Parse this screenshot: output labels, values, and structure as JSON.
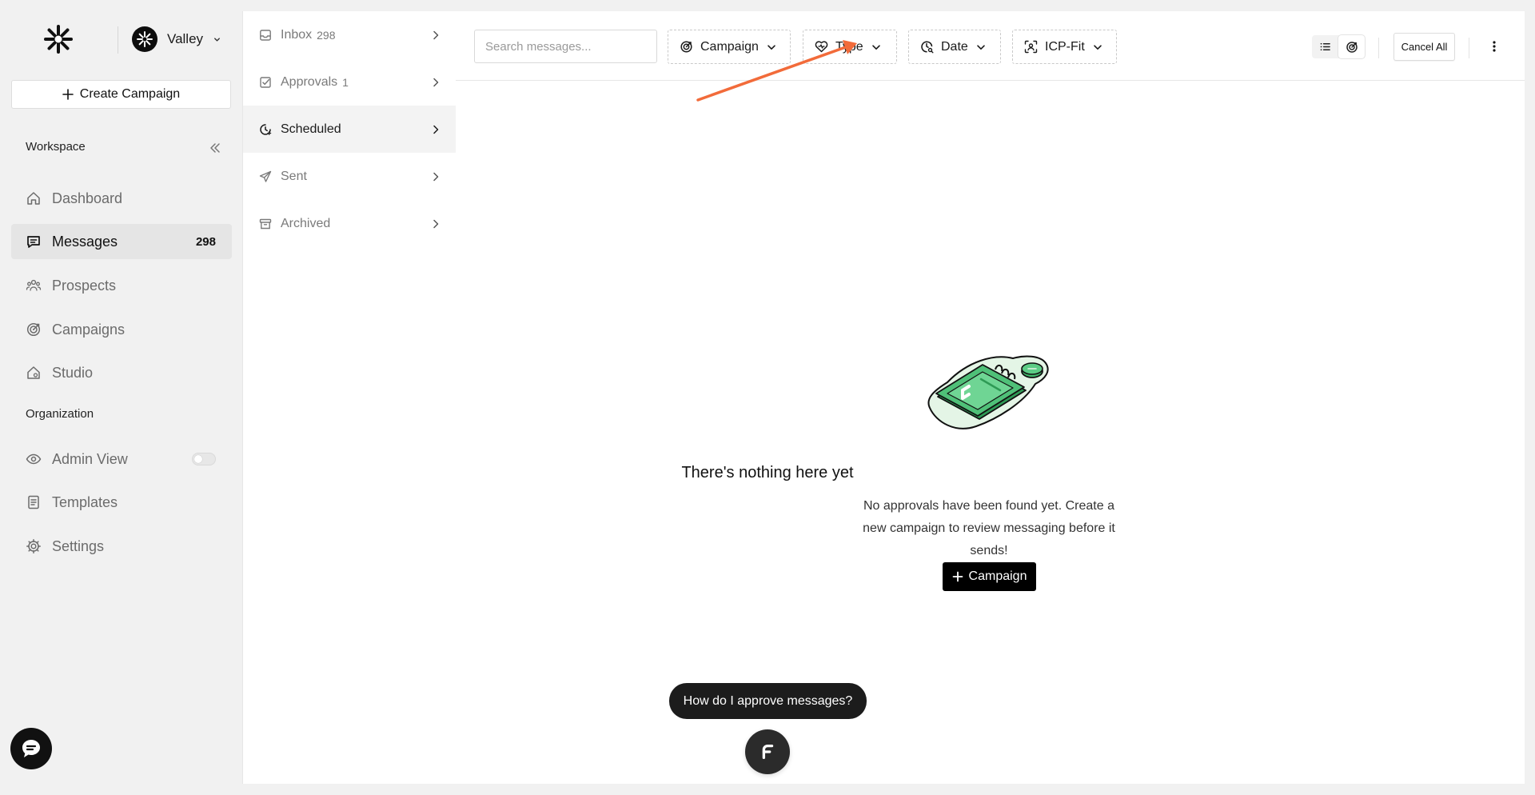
{
  "brand": {
    "logo_icon": "asterisk-logo-icon"
  },
  "org": {
    "name": "Valley"
  },
  "sidebar": {
    "create_label": "Create Campaign",
    "workspace_label": "Workspace",
    "organization_label": "Organization",
    "items": [
      {
        "label": "Dashboard",
        "icon": "home-icon"
      },
      {
        "label": "Messages",
        "icon": "message-icon",
        "count": "298",
        "active": true
      },
      {
        "label": "Prospects",
        "icon": "people-icon"
      },
      {
        "label": "Campaigns",
        "icon": "target-icon"
      },
      {
        "label": "Studio",
        "icon": "studio-icon"
      }
    ],
    "org_items": [
      {
        "label": "Admin View",
        "icon": "eye-icon",
        "toggle": false
      },
      {
        "label": "Templates",
        "icon": "document-icon"
      },
      {
        "label": "Settings",
        "icon": "gear-icon"
      }
    ]
  },
  "folders": [
    {
      "label": "Inbox",
      "count": "298",
      "icon": "inbox-icon"
    },
    {
      "label": "Approvals",
      "count": "1",
      "icon": "checkbox-icon"
    },
    {
      "label": "Scheduled",
      "count": "",
      "icon": "clock-icon",
      "active": true
    },
    {
      "label": "Sent",
      "count": "",
      "icon": "send-icon"
    },
    {
      "label": "Archived",
      "count": "",
      "icon": "archive-icon"
    }
  ],
  "toolbar": {
    "search_placeholder": "Search messages...",
    "filters": [
      {
        "label": "Campaign",
        "icon": "target-icon"
      },
      {
        "label": "Type",
        "icon": "heart-icon"
      },
      {
        "label": "Date",
        "icon": "clock-search-icon"
      },
      {
        "label": "ICP-Fit",
        "icon": "scan-face-icon"
      }
    ],
    "cancel_label": "Cancel All"
  },
  "empty_state": {
    "title": "There's nothing here yet",
    "description": "No approvals have been found yet. Create a new campaign to review messaging before it sends!",
    "cta_label": "Campaign"
  },
  "assistant": {
    "prompt": "How do I approve messages?"
  },
  "colors": {
    "annotation_arrow": "#f26b3a",
    "illustration_green": "#3fb86a",
    "illustration_bg": "#e4f5e6"
  }
}
